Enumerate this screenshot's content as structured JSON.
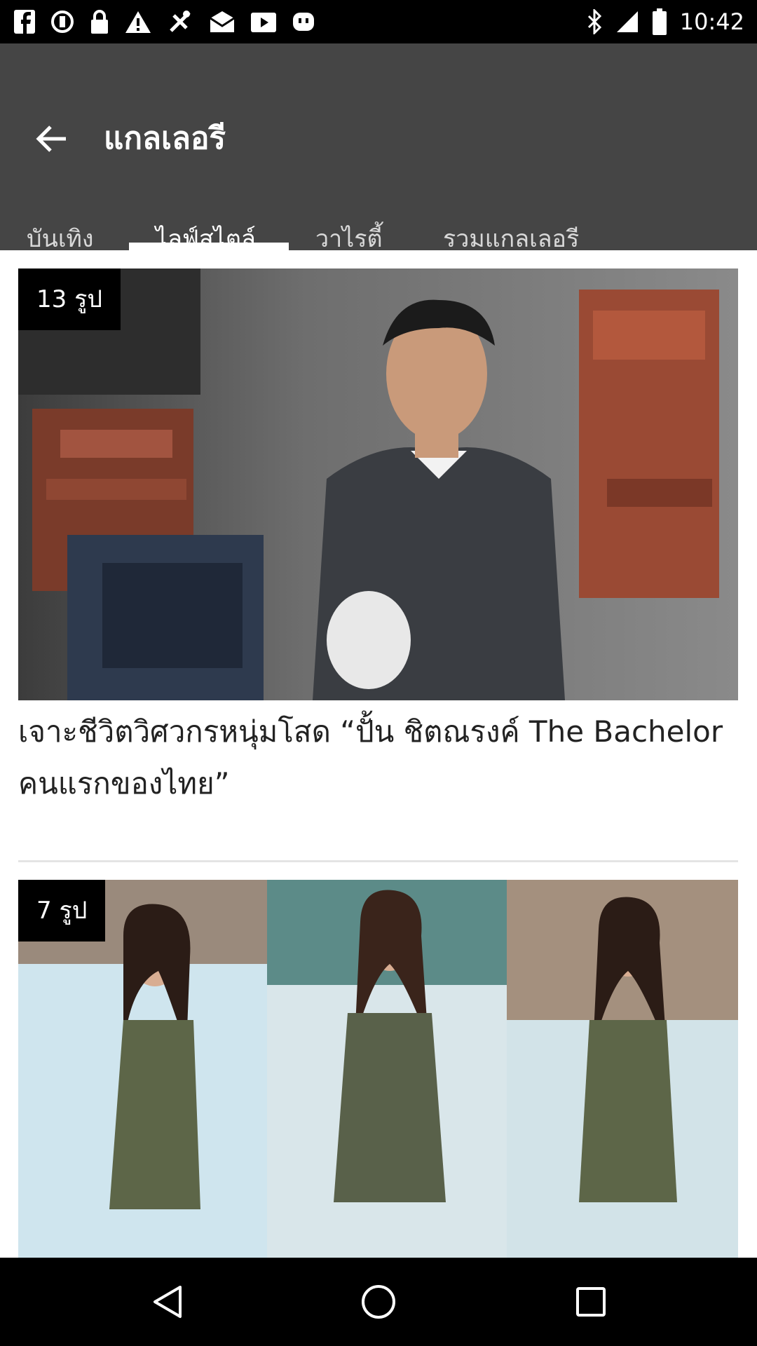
{
  "status_bar": {
    "time": "10:42",
    "icons": [
      "facebook-icon",
      "sync-icon",
      "lock-icon",
      "warning-icon",
      "fake-gps-icon",
      "mail-icon",
      "video-icon",
      "bbm-icon",
      "bluetooth-icon",
      "signal-icon",
      "battery-icon"
    ]
  },
  "app_bar": {
    "title": "แกลเลอรี",
    "back_icon": "back-arrow-icon",
    "background": "#454545"
  },
  "tabs": [
    {
      "label": "บันเทิง",
      "active": false
    },
    {
      "label": "ไลฟ์สไตล์",
      "active": true
    },
    {
      "label": "วาไรตี้",
      "active": false
    },
    {
      "label": "รวมแกลเลอรี",
      "active": false
    }
  ],
  "gallery": [
    {
      "badge": "13 รูป",
      "headline": "เจาะชีวิตวิศวกรหนุ่มโสด “ปั้น ชิตณรงค์ The Bachelor คนแรกของไทย”"
    },
    {
      "badge": "7 รูป"
    }
  ],
  "nav_bar": {
    "icons": [
      "back-triangle-icon",
      "home-circle-icon",
      "recents-square-icon"
    ]
  }
}
